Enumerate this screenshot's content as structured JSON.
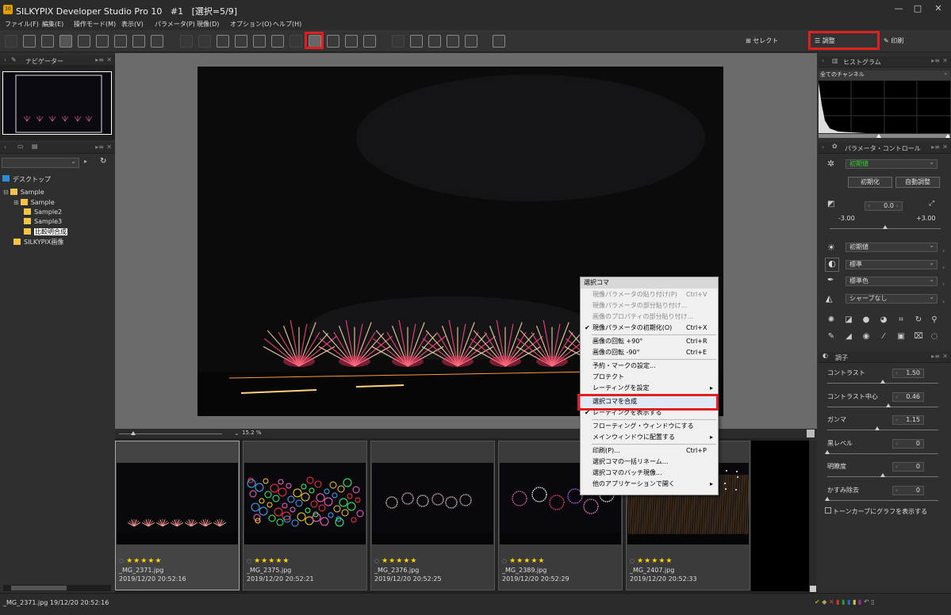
{
  "title": {
    "app": "SILKYPIX Developer Studio Pro 10",
    "doc": "#1",
    "sel": "[選択=5/9]",
    "icon": "10"
  },
  "window_buttons": [
    "—",
    "□",
    "✕"
  ],
  "menu": [
    "ファイル(F)",
    "編集(E)",
    "操作モード(M)",
    "表示(V)",
    "パラメータ(P)",
    "現像(D)",
    "オプション(O)",
    "ヘルプ(H)"
  ],
  "modes": {
    "select": "セレクト",
    "adjust": "調整",
    "print": "印刷"
  },
  "navigator": {
    "title": "ナビゲーター"
  },
  "tree": {
    "root": "デスクトップ",
    "items": [
      "Sample",
      "Sample",
      "Sample2",
      "Sample3",
      "比較明合成",
      "SILKYPIX画像"
    ]
  },
  "zoom": {
    "value": "15.2",
    "unit": "%"
  },
  "thumbs": [
    {
      "file": "_MG_2371.jpg",
      "time": "2019/12/20 20:52:16",
      "stars": "★★★★★",
      "dot": "○",
      "kind": "fan"
    },
    {
      "file": "_MG_2375.jpg",
      "time": "2019/12/20 20:52:21",
      "stars": "★★★★★",
      "dot": "○",
      "kind": "burst"
    },
    {
      "file": "_MG_2376.jpg",
      "time": "2019/12/20 20:52:25",
      "stars": "★★★★★",
      "dot": "○",
      "kind": "peony"
    },
    {
      "file": "_MG_2389.jpg",
      "time": "2019/12/20 20:52:29",
      "stars": "★★★★★",
      "dot": "○",
      "kind": "ring"
    },
    {
      "file": "_MG_2407.jpg",
      "time": "2019/12/20 20:52:33",
      "stars": "★★★★★",
      "dot": "○",
      "kind": "willow"
    }
  ],
  "status": {
    "text": "_MG_2371.jpg 19/12/20 20:52:16"
  },
  "histogram": {
    "title": "ヒストグラム",
    "channel": "全てのチャンネル"
  },
  "param_control": {
    "title": "パラメータ・コントロール",
    "preset": "初期値",
    "init_button": "初期化",
    "auto_button": "自動調整",
    "exposure": {
      "value": "0.0",
      "min": "-3.00",
      "max": "+3.00",
      "level": 0.5
    },
    "wb": "初期値",
    "tone": "標準",
    "color": "標準色",
    "sharp": "シャープなし"
  },
  "tone_panel": {
    "title": "調子",
    "params": [
      {
        "label": "コントラスト",
        "value": "1.50",
        "level": 0.5
      },
      {
        "label": "コントラスト中心",
        "value": "0.46",
        "level": 0.55
      },
      {
        "label": "ガンマ",
        "value": "1.15",
        "level": 0.45
      },
      {
        "label": "黒レベル",
        "value": "0",
        "level": 0.0
      },
      {
        "label": "明瞭度",
        "value": "0",
        "level": 0.5
      },
      {
        "label": "かすみ除去",
        "value": "0",
        "level": 0.0
      }
    ],
    "curve_check": "トーンカーブにグラフを表示する"
  },
  "context_menu": {
    "header": "選択コマ",
    "items": [
      {
        "label": "現像パラメータの貼り付け(P)",
        "key": "Ctrl+V",
        "disabled": true
      },
      {
        "label": "現像パラメータの部分貼り付け...",
        "disabled": true
      },
      {
        "label": "画像のプロパティの部分貼り付け...",
        "disabled": true
      },
      {
        "label": "現像パラメータの初期化(O)",
        "key": "Ctrl+X",
        "check": "✔"
      },
      {
        "sep": true
      },
      {
        "label": "画像の回転 +90°",
        "key": "Ctrl+R"
      },
      {
        "label": "画像の回転 -90°",
        "key": "Ctrl+E"
      },
      {
        "sep": true
      },
      {
        "label": "予約・マークの設定..."
      },
      {
        "label": "プロテクト"
      },
      {
        "label": "レーティングを設定",
        "arrow": "▸"
      },
      {
        "sep": true
      },
      {
        "label": "選択コマを合成",
        "highlight": true
      },
      {
        "label": "レーティングを表示する",
        "check": "✔"
      },
      {
        "sep": true
      },
      {
        "label": "フローティング・ウィンドウにする"
      },
      {
        "label": "メインウィンドウに配置する",
        "arrow": "▸"
      },
      {
        "sep": true
      },
      {
        "label": "印刷(P)...",
        "key": "Ctrl+P"
      },
      {
        "label": "選択コマの一括リネーム..."
      },
      {
        "label": "選択コマのバッチ現像..."
      },
      {
        "label": "他のアプリケーションで開く",
        "arrow": "▸"
      }
    ]
  },
  "colors": {
    "highlight": "#e02020",
    "star": "#ffd200",
    "folder": "#f2c54a"
  }
}
